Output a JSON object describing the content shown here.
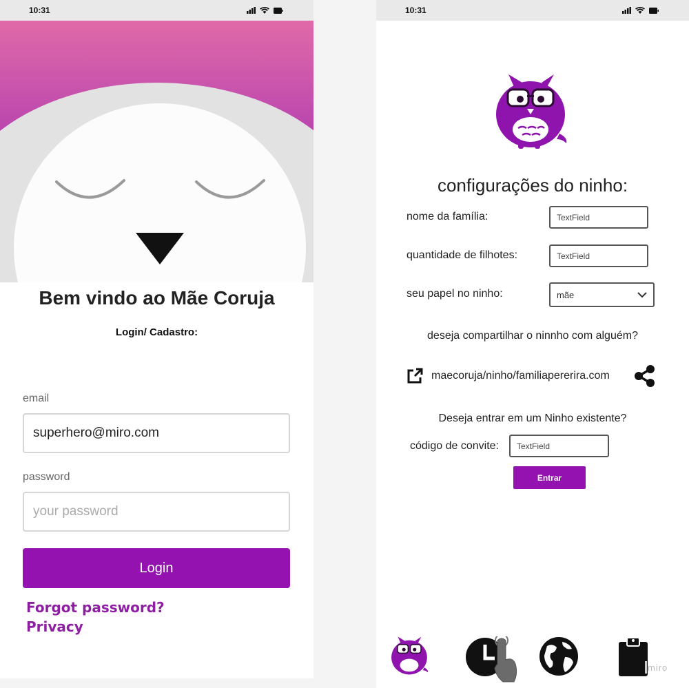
{
  "left_screen": {
    "status": {
      "time": "10:31"
    },
    "welcome_title": "Bem vindo ao Mãe Coruja",
    "subtitle": "Login/ Cadastro:",
    "email": {
      "label": "email",
      "value": "superhero@miro.com"
    },
    "password": {
      "label": "password",
      "placeholder": "your password"
    },
    "login_label": "Login",
    "forgot_label": "Forgot password?",
    "privacy_label": "Privacy"
  },
  "right_screen": {
    "status": {
      "time": "10:31"
    },
    "title": "configurações do ninho:",
    "family_name": {
      "label": "nome da família:",
      "value": "TextField"
    },
    "kids_count": {
      "label": "quantidade de filhotes:",
      "value": "TextField"
    },
    "role": {
      "label": "seu papel no ninho:",
      "selected": "mãe"
    },
    "share_question": "deseja compartilhar o ninnho com alguém?",
    "share_url": "maecoruja/ninho/familiapererira.com",
    "join_question": "Deseja entrar em um Ninho existente?",
    "invite": {
      "label": "código de convite:",
      "value": "TextField"
    },
    "enter_label": "Entrar",
    "nav": {
      "items": [
        "owl-icon",
        "clock-icon",
        "globe-icon",
        "clipboard-icon"
      ]
    },
    "watermark": "miro"
  },
  "colors": {
    "brand_purple": "#9412b0",
    "link_purple": "#8e1fa3",
    "gradient_top": "#e06aa8",
    "gradient_bottom": "#8a1fa8"
  }
}
